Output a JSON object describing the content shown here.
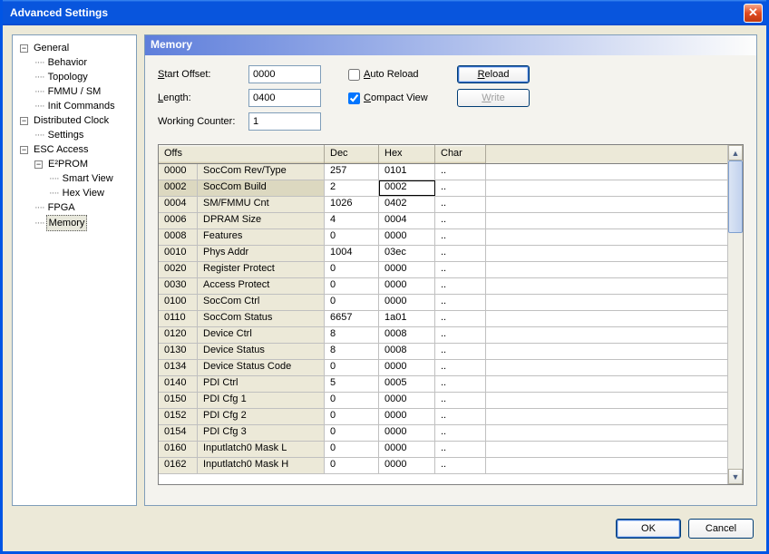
{
  "window": {
    "title": "Advanced Settings"
  },
  "tree": {
    "general": "General",
    "behavior": "Behavior",
    "topology": "Topology",
    "fmmu": "FMMU / SM",
    "init": "Init Commands",
    "distclock": "Distributed Clock",
    "settings": "Settings",
    "esc": "ESC Access",
    "eeprom": "E²PROM",
    "smartview": "Smart View",
    "hexview": "Hex View",
    "fpga": "FPGA",
    "memory": "Memory"
  },
  "panel": {
    "title": "Memory"
  },
  "form": {
    "start_offset_label": "Start Offset:",
    "start_offset_value": "0000",
    "length_label": "Length:",
    "length_value": "0400",
    "working_counter_label": "Working Counter:",
    "working_counter_value": "1",
    "auto_reload_label": "Auto Reload",
    "auto_reload_checked": false,
    "compact_view_label": "Compact View",
    "compact_view_checked": true,
    "reload_label": "Reload",
    "write_label": "Write"
  },
  "grid": {
    "headers": {
      "offs": "Offs",
      "dec": "Dec",
      "hex": "Hex",
      "char": "Char"
    },
    "rows": [
      {
        "offs": "0000",
        "name": "SocCom Rev/Type",
        "dec": "257",
        "hex": "0101",
        "char": ".."
      },
      {
        "offs": "0002",
        "name": "SocCom Build",
        "dec": "2",
        "hex": "0002",
        "char": ".."
      },
      {
        "offs": "0004",
        "name": "SM/FMMU Cnt",
        "dec": "1026",
        "hex": "0402",
        "char": ".."
      },
      {
        "offs": "0006",
        "name": "DPRAM Size",
        "dec": "4",
        "hex": "0004",
        "char": ".."
      },
      {
        "offs": "0008",
        "name": "Features",
        "dec": "0",
        "hex": "0000",
        "char": ".."
      },
      {
        "offs": "0010",
        "name": "Phys Addr",
        "dec": "1004",
        "hex": "03ec",
        "char": ".."
      },
      {
        "offs": "0020",
        "name": "Register Protect",
        "dec": "0",
        "hex": "0000",
        "char": ".."
      },
      {
        "offs": "0030",
        "name": "Access Protect",
        "dec": "0",
        "hex": "0000",
        "char": ".."
      },
      {
        "offs": "0100",
        "name": "SocCom Ctrl",
        "dec": "0",
        "hex": "0000",
        "char": ".."
      },
      {
        "offs": "0110",
        "name": "SocCom Status",
        "dec": "6657",
        "hex": "1a01",
        "char": ".."
      },
      {
        "offs": "0120",
        "name": "Device Ctrl",
        "dec": "8",
        "hex": "0008",
        "char": ".."
      },
      {
        "offs": "0130",
        "name": "Device Status",
        "dec": "8",
        "hex": "0008",
        "char": ".."
      },
      {
        "offs": "0134",
        "name": "Device Status Code",
        "dec": "0",
        "hex": "0000",
        "char": ".."
      },
      {
        "offs": "0140",
        "name": "PDI Ctrl",
        "dec": "5",
        "hex": "0005",
        "char": ".."
      },
      {
        "offs": "0150",
        "name": "PDI Cfg 1",
        "dec": "0",
        "hex": "0000",
        "char": ".."
      },
      {
        "offs": "0152",
        "name": "PDI Cfg 2",
        "dec": "0",
        "hex": "0000",
        "char": ".."
      },
      {
        "offs": "0154",
        "name": "PDI Cfg 3",
        "dec": "0",
        "hex": "0000",
        "char": ".."
      },
      {
        "offs": "0160",
        "name": "Inputlatch0 Mask L",
        "dec": "0",
        "hex": "0000",
        "char": ".."
      },
      {
        "offs": "0162",
        "name": "Inputlatch0 Mask H",
        "dec": "0",
        "hex": "0000",
        "char": ".."
      }
    ],
    "selected_row": 1
  },
  "footer": {
    "ok": "OK",
    "cancel": "Cancel"
  }
}
